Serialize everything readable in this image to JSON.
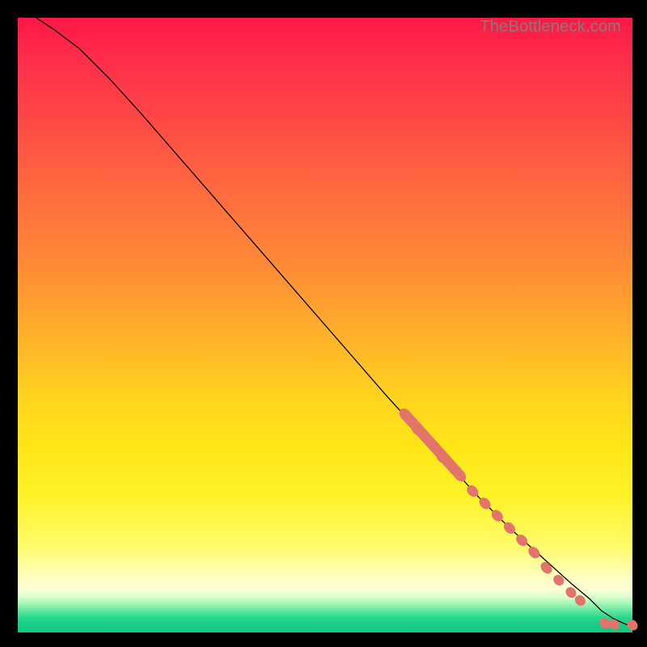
{
  "attribution": "TheBottleneck.com",
  "chart_data": {
    "type": "line",
    "title": "",
    "xlabel": "",
    "ylabel": "",
    "xlim": [
      0,
      100
    ],
    "ylim": [
      0,
      100
    ],
    "series": [
      {
        "name": "curve",
        "x": [
          3,
          6,
          10,
          15,
          20,
          30,
          40,
          50,
          60,
          70,
          75,
          80,
          85,
          90,
          93,
          95,
          97,
          99,
          100
        ],
        "y": [
          100,
          98,
          95,
          90,
          84.5,
          73,
          61.5,
          50,
          38.5,
          27.5,
          22,
          17,
          12.5,
          8,
          5.5,
          3.5,
          2.2,
          1.3,
          1.2
        ]
      }
    ],
    "highlight_points": [
      {
        "x": 63,
        "y": 35.5
      },
      {
        "x": 65,
        "y": 33
      },
      {
        "x": 67,
        "y": 31
      },
      {
        "x": 69,
        "y": 28.5
      },
      {
        "x": 71,
        "y": 26.5
      },
      {
        "x": 72,
        "y": 25.5
      },
      {
        "x": 74,
        "y": 23
      },
      {
        "x": 76,
        "y": 21
      },
      {
        "x": 78,
        "y": 19
      },
      {
        "x": 80,
        "y": 17
      },
      {
        "x": 82,
        "y": 15
      },
      {
        "x": 84,
        "y": 13
      },
      {
        "x": 86,
        "y": 10.5
      },
      {
        "x": 88,
        "y": 8.5
      },
      {
        "x": 90,
        "y": 6.5
      },
      {
        "x": 91.5,
        "y": 5.2
      },
      {
        "x": 95.5,
        "y": 1.5
      },
      {
        "x": 97,
        "y": 1.3
      },
      {
        "x": 100,
        "y": 1.2
      }
    ],
    "gradient_colors": {
      "top": "#ff1745",
      "mid": "#ffe617",
      "bottom": "#10c982"
    }
  }
}
